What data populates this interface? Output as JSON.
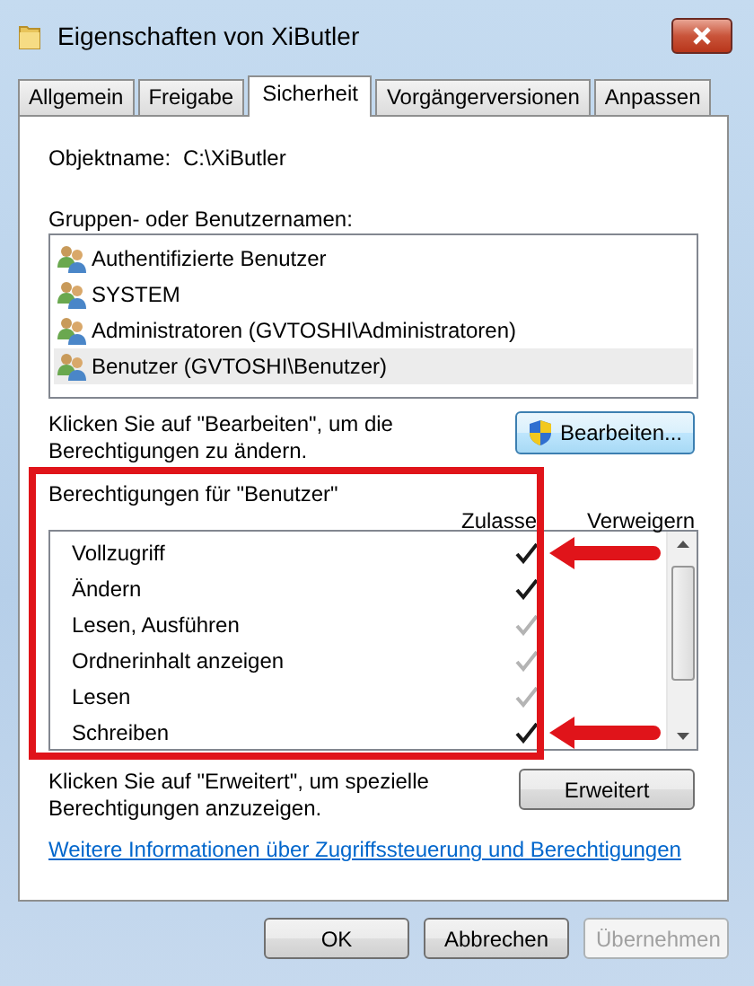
{
  "window": {
    "title": "Eigenschaften von XiButler"
  },
  "tabs": [
    {
      "label": "Allgemein",
      "selected": false
    },
    {
      "label": "Freigabe",
      "selected": false
    },
    {
      "label": "Sicherheit",
      "selected": true
    },
    {
      "label": "Vorgängerversionen",
      "selected": false
    },
    {
      "label": "Anpassen",
      "selected": false
    }
  ],
  "object_name": {
    "label": "Objektname:",
    "value": "C:\\XiButler"
  },
  "groups": {
    "label": "Gruppen- oder Benutzernamen:",
    "items": [
      {
        "name": "Authentifizierte Benutzer",
        "selected": false
      },
      {
        "name": "SYSTEM",
        "selected": false
      },
      {
        "name": "Administratoren (GVTOSHI\\Administratoren)",
        "selected": false
      },
      {
        "name": "Benutzer (GVTOSHI\\Benutzer)",
        "selected": true
      }
    ]
  },
  "edit": {
    "hint": "Klicken Sie auf \"Bearbeiten\", um die Berechtigungen zu ändern.",
    "button": "Bearbeiten..."
  },
  "permissions": {
    "label": "Berechtigungen für \"Benutzer\"",
    "columns": [
      "Zulasse",
      "Verweigern"
    ],
    "rows": [
      {
        "name": "Vollzugriff",
        "allow": true,
        "inherited": false,
        "arrow": true
      },
      {
        "name": "Ändern",
        "allow": true,
        "inherited": false,
        "arrow": false
      },
      {
        "name": "Lesen, Ausführen",
        "allow": true,
        "inherited": true,
        "arrow": false
      },
      {
        "name": "Ordnerinhalt anzeigen",
        "allow": true,
        "inherited": true,
        "arrow": false
      },
      {
        "name": "Lesen",
        "allow": true,
        "inherited": true,
        "arrow": false
      },
      {
        "name": "Schreiben",
        "allow": true,
        "inherited": false,
        "arrow": true
      }
    ]
  },
  "advanced": {
    "hint": "Klicken Sie auf \"Erweitert\", um spezielle Berechtigungen anzuzeigen.",
    "button": "Erweitert"
  },
  "link": "Weitere Informationen über Zugriffssteuerung und Berechtigungen",
  "buttons": [
    {
      "label": "OK",
      "disabled": false
    },
    {
      "label": "Abbrechen",
      "disabled": false
    },
    {
      "label": "Übernehmen",
      "disabled": true
    }
  ],
  "annotations": [
    {
      "kind": "frame"
    }
  ]
}
